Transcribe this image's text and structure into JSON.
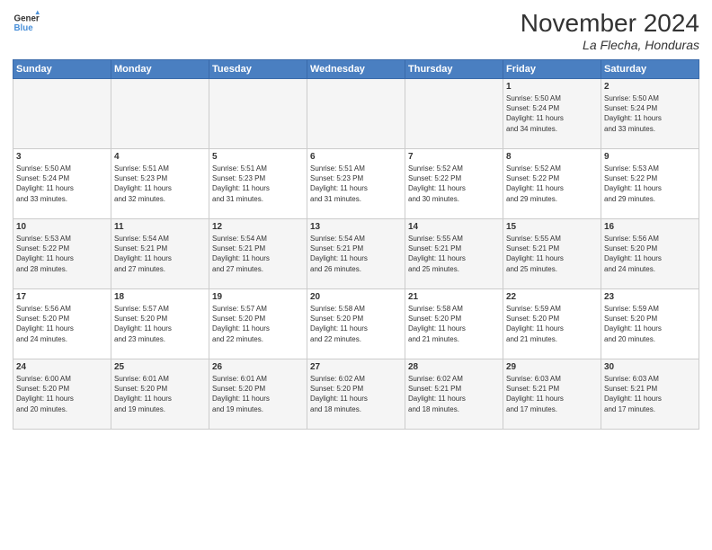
{
  "logo": {
    "line1": "General",
    "line2": "Blue"
  },
  "title": "November 2024",
  "location": "La Flecha, Honduras",
  "weekdays": [
    "Sunday",
    "Monday",
    "Tuesday",
    "Wednesday",
    "Thursday",
    "Friday",
    "Saturday"
  ],
  "weeks": [
    [
      {
        "num": "",
        "info": ""
      },
      {
        "num": "",
        "info": ""
      },
      {
        "num": "",
        "info": ""
      },
      {
        "num": "",
        "info": ""
      },
      {
        "num": "",
        "info": ""
      },
      {
        "num": "1",
        "info": "Sunrise: 5:50 AM\nSunset: 5:24 PM\nDaylight: 11 hours\nand 34 minutes."
      },
      {
        "num": "2",
        "info": "Sunrise: 5:50 AM\nSunset: 5:24 PM\nDaylight: 11 hours\nand 33 minutes."
      }
    ],
    [
      {
        "num": "3",
        "info": "Sunrise: 5:50 AM\nSunset: 5:24 PM\nDaylight: 11 hours\nand 33 minutes."
      },
      {
        "num": "4",
        "info": "Sunrise: 5:51 AM\nSunset: 5:23 PM\nDaylight: 11 hours\nand 32 minutes."
      },
      {
        "num": "5",
        "info": "Sunrise: 5:51 AM\nSunset: 5:23 PM\nDaylight: 11 hours\nand 31 minutes."
      },
      {
        "num": "6",
        "info": "Sunrise: 5:51 AM\nSunset: 5:23 PM\nDaylight: 11 hours\nand 31 minutes."
      },
      {
        "num": "7",
        "info": "Sunrise: 5:52 AM\nSunset: 5:22 PM\nDaylight: 11 hours\nand 30 minutes."
      },
      {
        "num": "8",
        "info": "Sunrise: 5:52 AM\nSunset: 5:22 PM\nDaylight: 11 hours\nand 29 minutes."
      },
      {
        "num": "9",
        "info": "Sunrise: 5:53 AM\nSunset: 5:22 PM\nDaylight: 11 hours\nand 29 minutes."
      }
    ],
    [
      {
        "num": "10",
        "info": "Sunrise: 5:53 AM\nSunset: 5:22 PM\nDaylight: 11 hours\nand 28 minutes."
      },
      {
        "num": "11",
        "info": "Sunrise: 5:54 AM\nSunset: 5:21 PM\nDaylight: 11 hours\nand 27 minutes."
      },
      {
        "num": "12",
        "info": "Sunrise: 5:54 AM\nSunset: 5:21 PM\nDaylight: 11 hours\nand 27 minutes."
      },
      {
        "num": "13",
        "info": "Sunrise: 5:54 AM\nSunset: 5:21 PM\nDaylight: 11 hours\nand 26 minutes."
      },
      {
        "num": "14",
        "info": "Sunrise: 5:55 AM\nSunset: 5:21 PM\nDaylight: 11 hours\nand 25 minutes."
      },
      {
        "num": "15",
        "info": "Sunrise: 5:55 AM\nSunset: 5:21 PM\nDaylight: 11 hours\nand 25 minutes."
      },
      {
        "num": "16",
        "info": "Sunrise: 5:56 AM\nSunset: 5:20 PM\nDaylight: 11 hours\nand 24 minutes."
      }
    ],
    [
      {
        "num": "17",
        "info": "Sunrise: 5:56 AM\nSunset: 5:20 PM\nDaylight: 11 hours\nand 24 minutes."
      },
      {
        "num": "18",
        "info": "Sunrise: 5:57 AM\nSunset: 5:20 PM\nDaylight: 11 hours\nand 23 minutes."
      },
      {
        "num": "19",
        "info": "Sunrise: 5:57 AM\nSunset: 5:20 PM\nDaylight: 11 hours\nand 22 minutes."
      },
      {
        "num": "20",
        "info": "Sunrise: 5:58 AM\nSunset: 5:20 PM\nDaylight: 11 hours\nand 22 minutes."
      },
      {
        "num": "21",
        "info": "Sunrise: 5:58 AM\nSunset: 5:20 PM\nDaylight: 11 hours\nand 21 minutes."
      },
      {
        "num": "22",
        "info": "Sunrise: 5:59 AM\nSunset: 5:20 PM\nDaylight: 11 hours\nand 21 minutes."
      },
      {
        "num": "23",
        "info": "Sunrise: 5:59 AM\nSunset: 5:20 PM\nDaylight: 11 hours\nand 20 minutes."
      }
    ],
    [
      {
        "num": "24",
        "info": "Sunrise: 6:00 AM\nSunset: 5:20 PM\nDaylight: 11 hours\nand 20 minutes."
      },
      {
        "num": "25",
        "info": "Sunrise: 6:01 AM\nSunset: 5:20 PM\nDaylight: 11 hours\nand 19 minutes."
      },
      {
        "num": "26",
        "info": "Sunrise: 6:01 AM\nSunset: 5:20 PM\nDaylight: 11 hours\nand 19 minutes."
      },
      {
        "num": "27",
        "info": "Sunrise: 6:02 AM\nSunset: 5:20 PM\nDaylight: 11 hours\nand 18 minutes."
      },
      {
        "num": "28",
        "info": "Sunrise: 6:02 AM\nSunset: 5:21 PM\nDaylight: 11 hours\nand 18 minutes."
      },
      {
        "num": "29",
        "info": "Sunrise: 6:03 AM\nSunset: 5:21 PM\nDaylight: 11 hours\nand 17 minutes."
      },
      {
        "num": "30",
        "info": "Sunrise: 6:03 AM\nSunset: 5:21 PM\nDaylight: 11 hours\nand 17 minutes."
      }
    ]
  ]
}
